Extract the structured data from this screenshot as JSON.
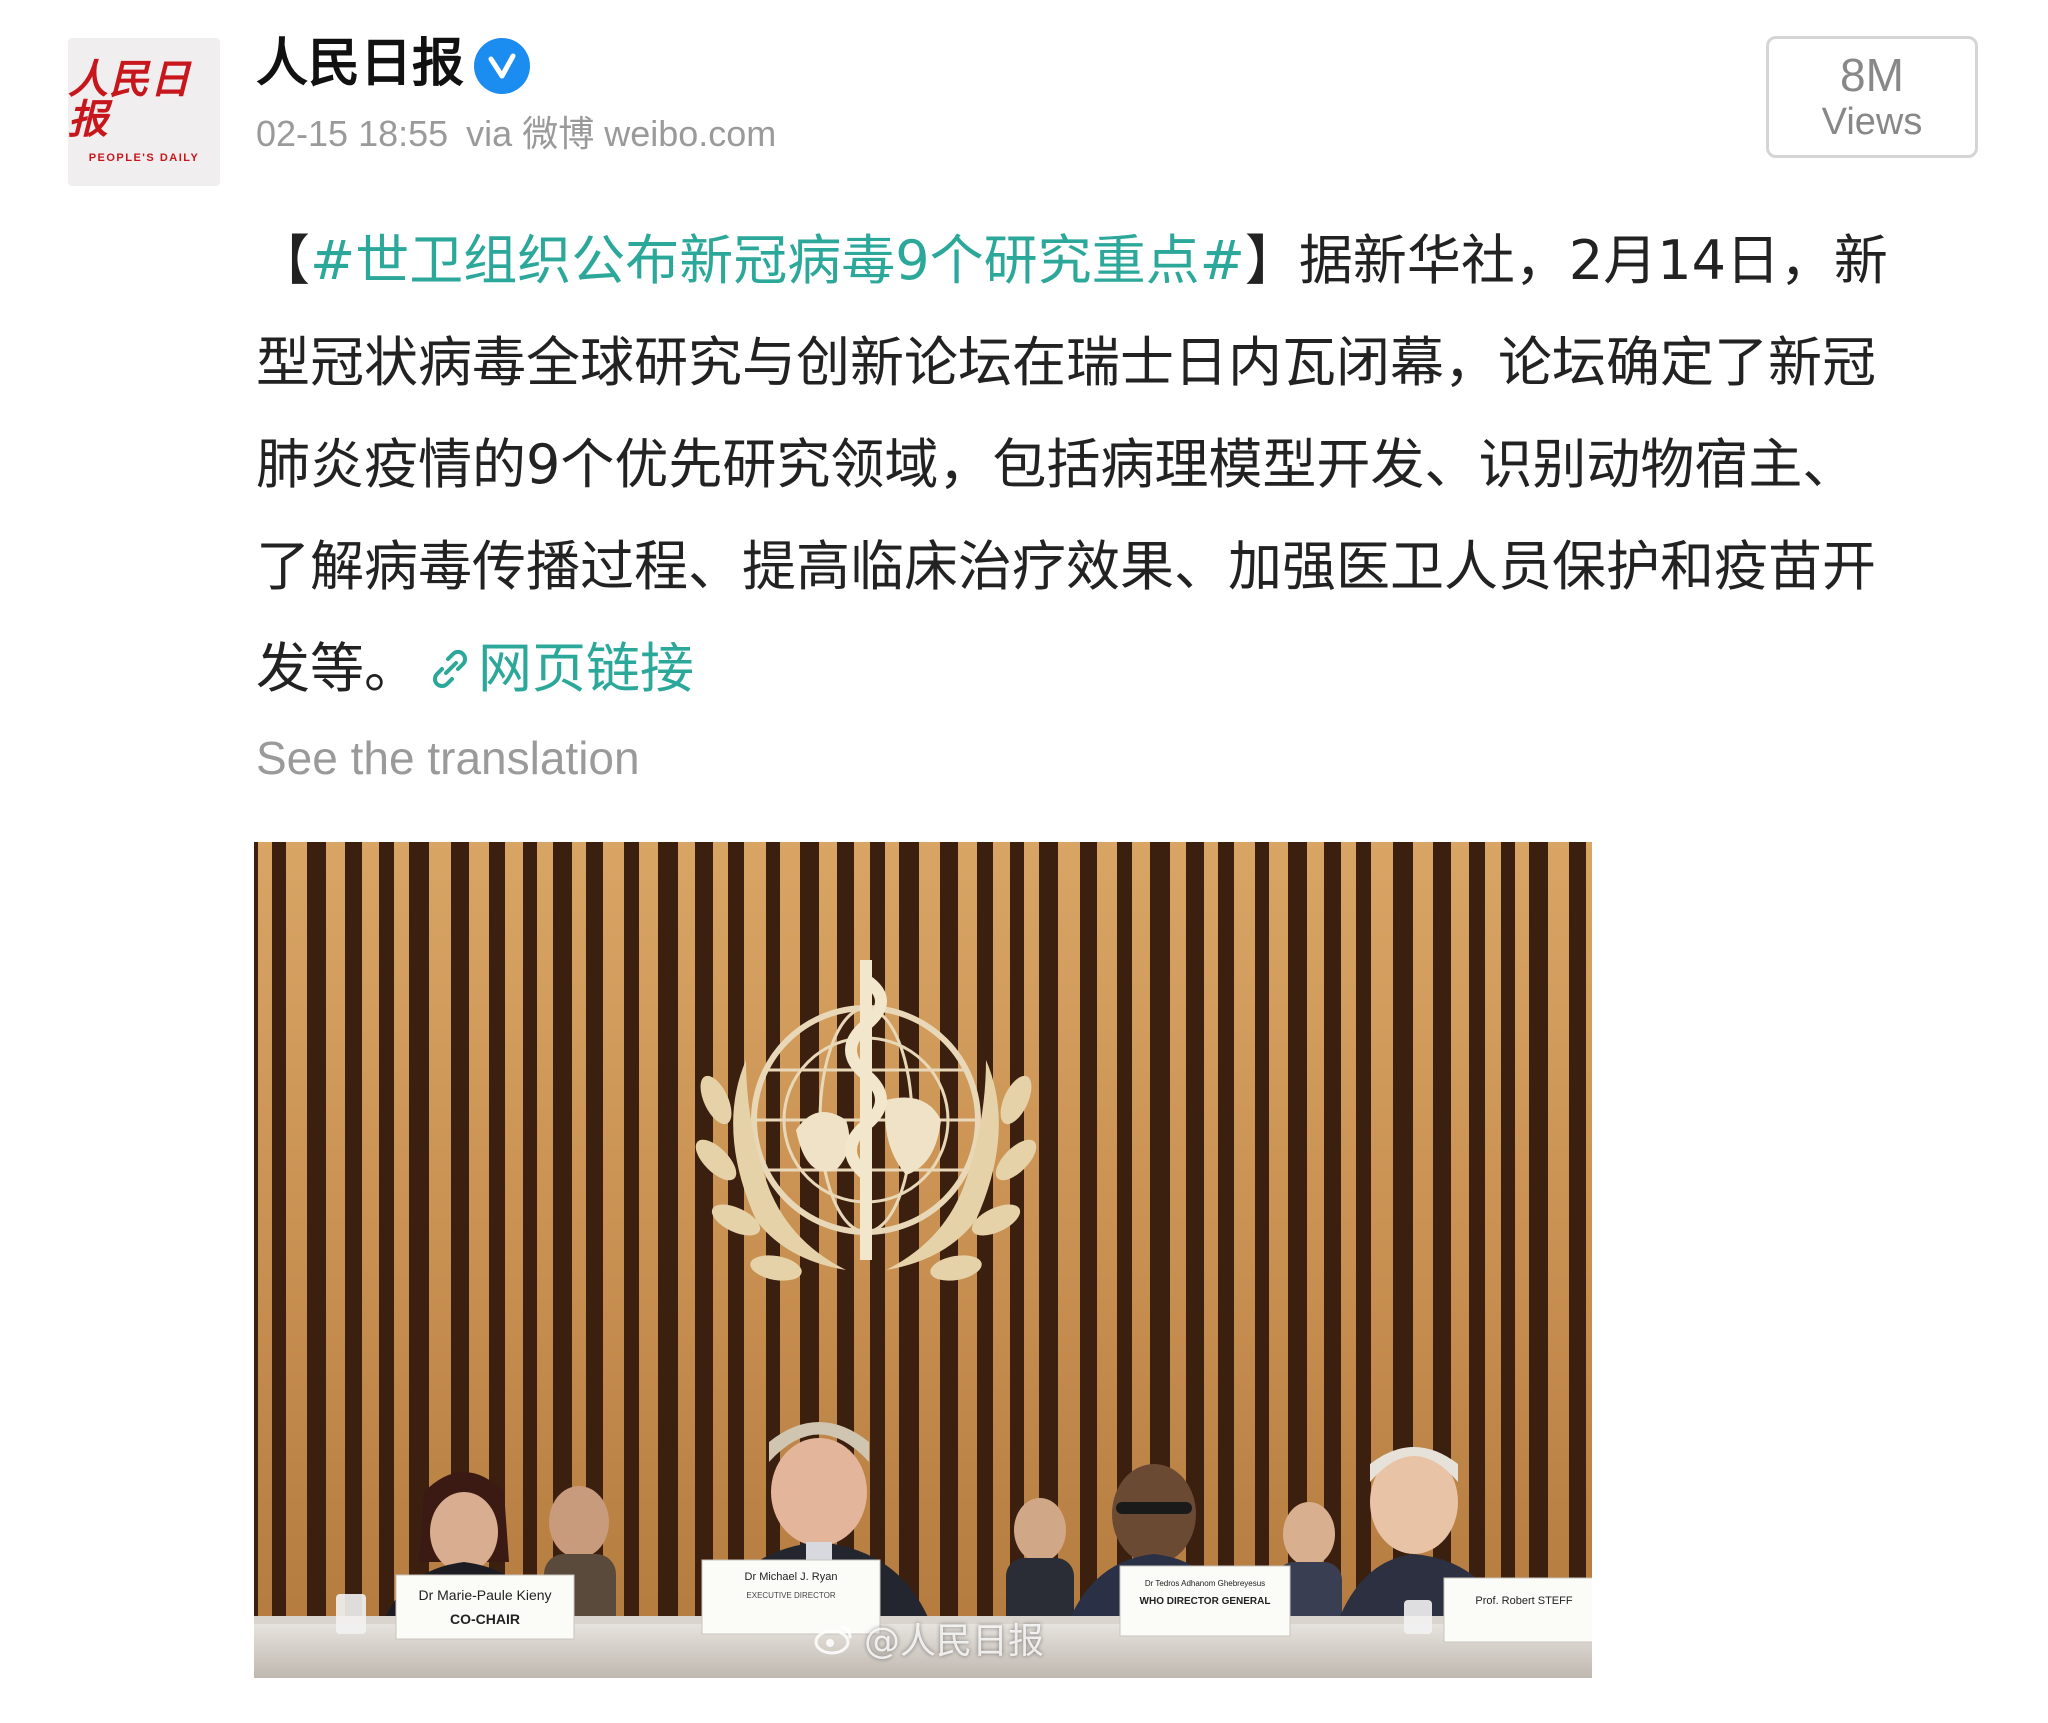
{
  "account": {
    "name": "人民日报",
    "avatar_logo_cn": "人民日报",
    "avatar_logo_en": "PEOPLE'S DAILY",
    "verified": true
  },
  "meta": {
    "timestamp": "02-15 18:55",
    "source": "via 微博 weibo.com"
  },
  "views": {
    "count": "8M",
    "label": "Views"
  },
  "post": {
    "bracket_open": "【",
    "hashtag": "#世卫组织公布新冠病毒9个研究重点#",
    "line1_rest": "】据新华社，2月14日，新",
    "line2": "型冠状病毒全球研究与创新论坛在瑞士日内瓦闭幕，论坛确定了新冠",
    "line3": "肺炎疫情的9个优先研究领域，包括病理模型开发、识别动物宿主、",
    "line4": "了解病毒传播过程、提高临床治疗效果、加强医卫人员保护和疫苗开",
    "line5_start": "发等。",
    "link_label": "网页链接"
  },
  "translate_label": "See the translation",
  "photo": {
    "watermark": "@人民日报",
    "nameplates": [
      {
        "name": "Dr Marie-Paule Kieny",
        "role": "CO-CHAIR"
      },
      {
        "name": "Dr Michael J. Ryan",
        "role": "EXECUTIVE DIRECTOR"
      },
      {
        "name": "Dr Tedros Adhanom Ghebreyesus",
        "role": "WHO DIRECTOR GENERAL"
      },
      {
        "name": "Prof. Robert STEFF",
        "role": ""
      }
    ]
  },
  "colors": {
    "link": "#2ba89a",
    "verified": "#1b8cf0",
    "meta_grey": "#9a9a9a",
    "logo_red": "#c8161d"
  }
}
